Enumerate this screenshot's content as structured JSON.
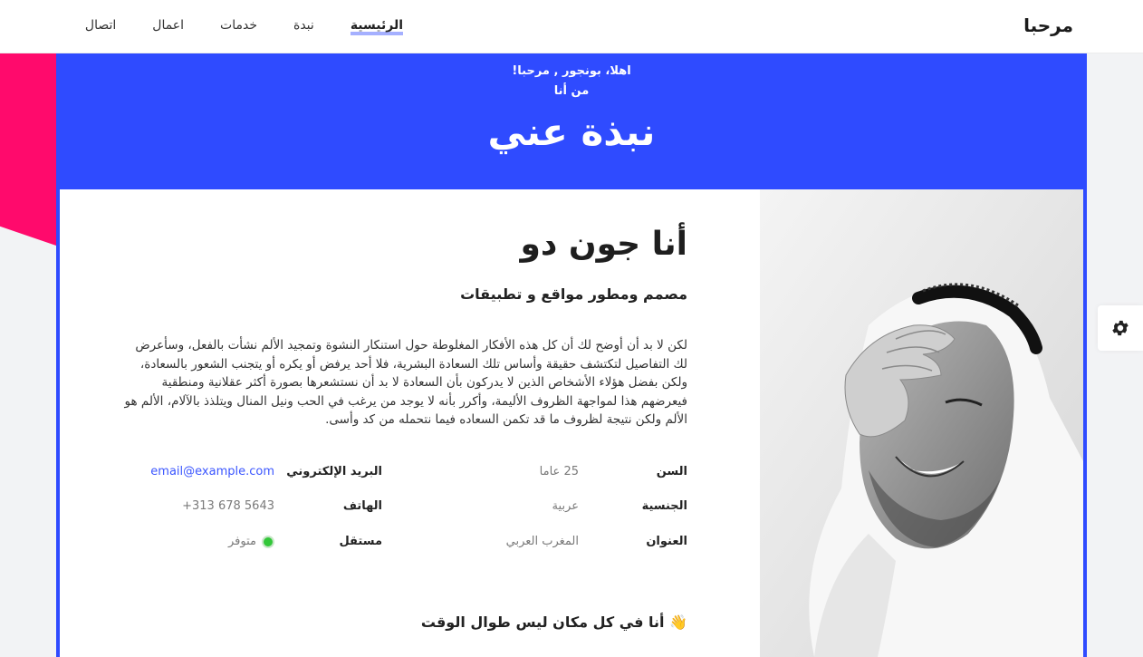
{
  "nav": {
    "brand": "مرحبا",
    "links": [
      "الرئيسية",
      "نبدة",
      "خدمات",
      "اعمال",
      "اتصال"
    ]
  },
  "hero": {
    "greeting": "اهلا، بونجور , مرحبا!",
    "sub": "من أنا",
    "title": "نبذة عني"
  },
  "profile": {
    "name": "أنا جون دو",
    "role": "مصمم ومطور مواقع و تطبيقات",
    "bio": "لكن لا بد أن أوضح لك أن كل هذه الأفكار المغلوطة حول استنكار النشوة وتمجيد الألم نشأت بالفعل، وسأعرض لك التفاصيل لتكتشف حقيقة وأساس تلك السعادة البشرية، فلا أحد يرفض أو يكره أو يتجنب الشعور بالسعادة، ولكن بفضل هؤلاء الأشخاص الذين لا يدركون بأن السعادة لا بد أن نستشعرها بصورة أكثر عقلانية ومنطقية فيعرضهم هذا لمواجهة الظروف الأليمة، وأكرر بأنه لا يوجد من يرغب في الحب ونيل المنال ويتلذذ بالآلام، الألم هو الألم ولكن نتيجة لظروف ما قد تكمن السعاده فيما نتحمله من كد وأسى.",
    "info": {
      "age_label": "السن",
      "age_value": "25 عاما",
      "nationality_label": "الجنسية",
      "nationality_value": "عربية",
      "address_label": "العنوان",
      "address_value": "المغرب العربي",
      "email_label": "البريد الإلكتروني",
      "email_value": "email@example.com",
      "phone_label": "الهاتف",
      "phone_value": "+313 678 5643",
      "freelance_label": "مستقل",
      "freelance_value": "متوفر"
    },
    "tagline": "👋 أنا في كل مكان ليس طوال الوقت"
  },
  "colors": {
    "hero_blue": "#2f4bff",
    "accent_pink": "#ff0a6c",
    "highlight": "#7d8cff",
    "available_green": "#32c739"
  },
  "icons": {
    "settings": "gear-icon"
  }
}
